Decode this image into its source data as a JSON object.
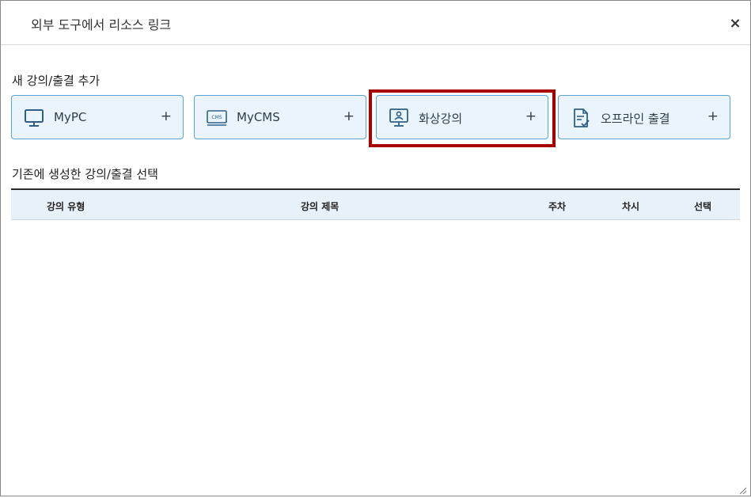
{
  "dialog": {
    "title": "외부 도구에서 리소스 링크",
    "close_label": "×"
  },
  "add_section": {
    "title": "새 강의/출결 추가",
    "buttons": [
      {
        "label": "MyPC",
        "icon": "monitor-icon",
        "plus": "+"
      },
      {
        "label": "MyCMS",
        "icon": "cms-icon",
        "plus": "+"
      },
      {
        "label": "화상강의",
        "icon": "video-lecture-icon",
        "plus": "+",
        "highlighted": true
      },
      {
        "label": "오프라인 출결",
        "icon": "document-check-icon",
        "plus": "+"
      }
    ],
    "cms_icon_text": "CMS"
  },
  "select_section": {
    "title": "기존에 생성한 강의/출결 선택",
    "columns": [
      "강의 유형",
      "강의 제목",
      "주차",
      "차시",
      "선택"
    ],
    "rows": []
  },
  "colors": {
    "button_bg": "#e9f4fc",
    "button_border": "#5aa3d6",
    "highlight": "#a70000",
    "table_header_bg": "#e9f1f8"
  }
}
